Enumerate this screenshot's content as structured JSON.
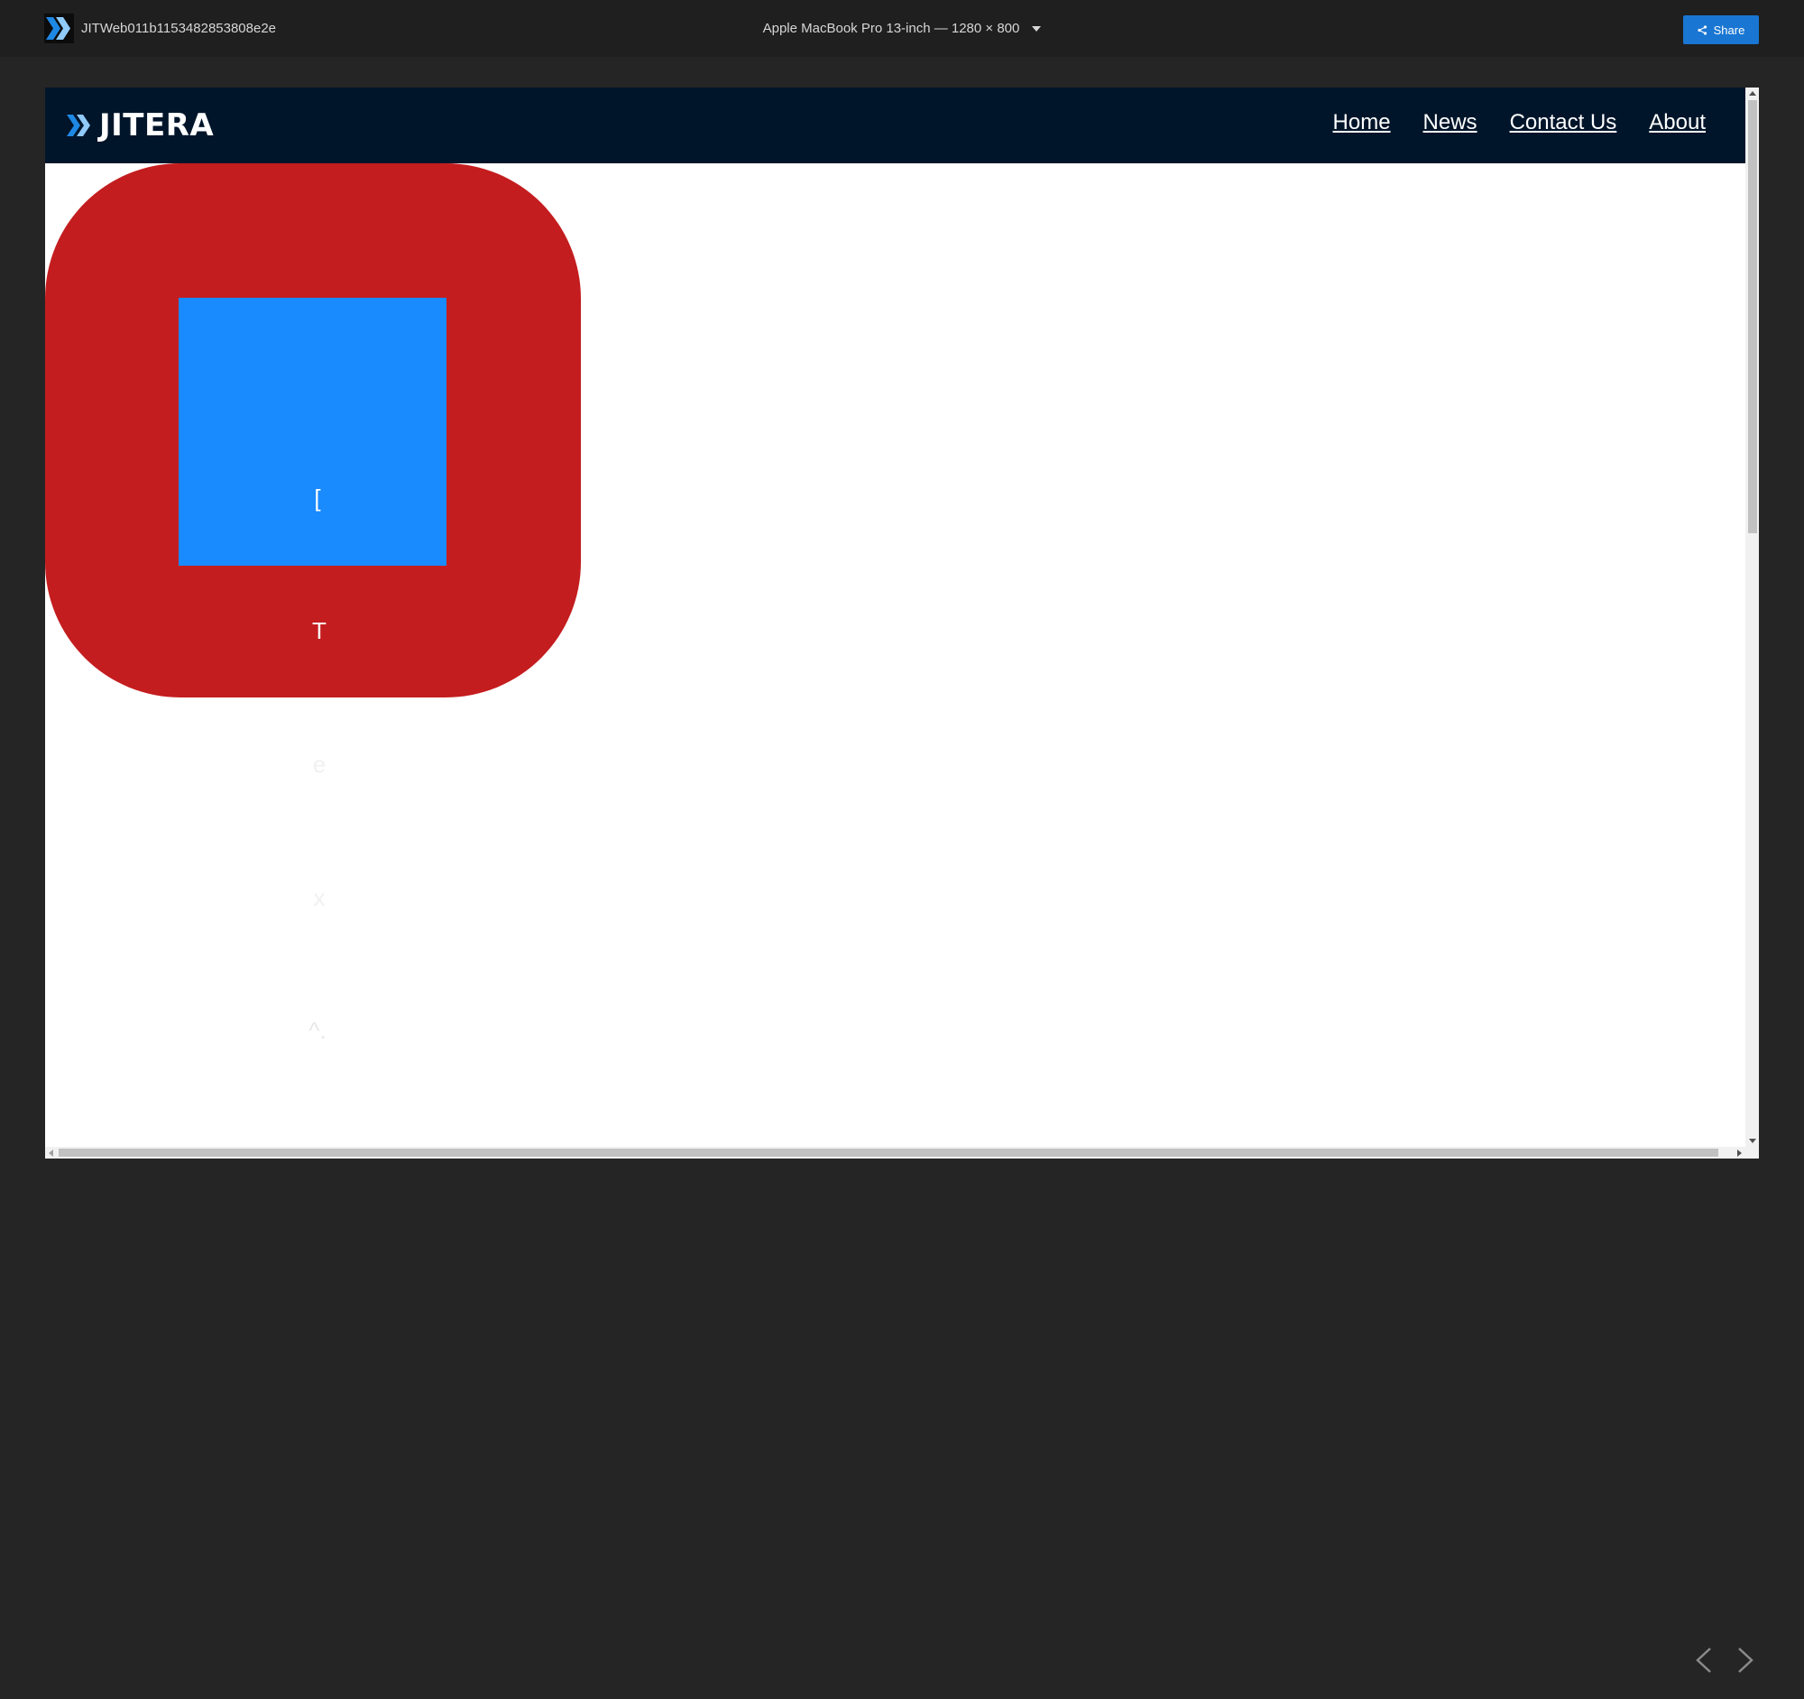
{
  "toolbar": {
    "project_name": "JITWeb011b1153482853808e2e",
    "device_label": "Apple MacBook Pro 13-inch — 1280 × 800",
    "share_label": "Share",
    "logo_icon": "jitera-chevrons-icon",
    "share_icon": "share-icon",
    "accent_color": "#1976d2"
  },
  "site": {
    "brand": "JITERA",
    "nav": [
      "Home",
      "News",
      "Contact Us",
      "About"
    ],
    "header_color": "#00152a"
  },
  "canvas": {
    "red_color": "#c41d1f",
    "blue_color": "#1a8aff",
    "glyphs": [
      "[",
      "T",
      "e",
      "x",
      "^."
    ]
  },
  "pager": {
    "prev_icon": "chevron-left-icon",
    "next_icon": "chevron-right-icon"
  }
}
